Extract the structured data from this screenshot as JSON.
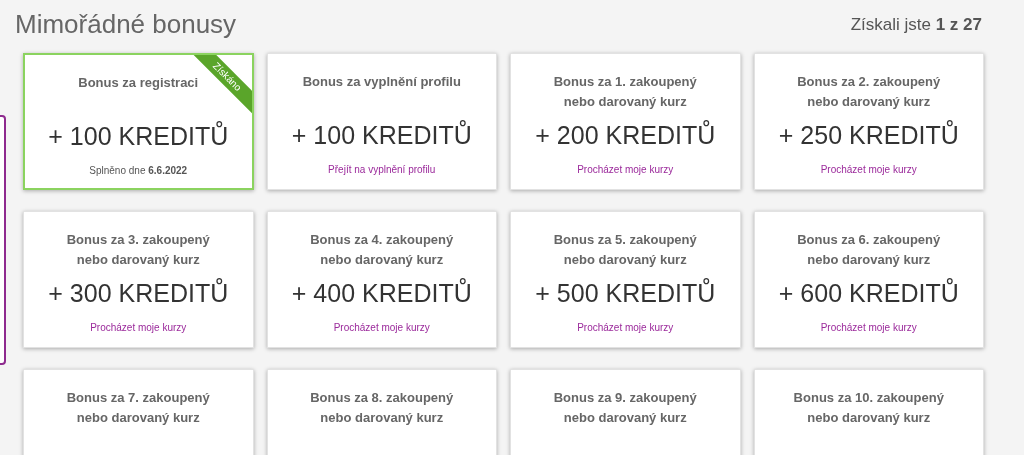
{
  "heading": "Mimořádné bonusy",
  "progress": "Získali jste **1 z 27**",
  "bonuses": [
    {
      "title": "Bonus za registraci",
      "amount": "+ 100 KREDITŮ",
      "footer": "Splněno dne **6.6.2022**",
      "earned": true,
      "ribbon": "Získáno"
    },
    {
      "title": "Bonus za vyplnění profilu",
      "amount": "+ 100 KREDITŮ",
      "footer": "Přejít na vyplnění profilu",
      "earned": false
    },
    {
      "title": "Bonus za 1. zakoupený nebo darovaný kurz",
      "amount": "+ 200 KREDITŮ",
      "footer": "Procházet moje kurzy",
      "earned": false
    },
    {
      "title": "Bonus za 2. zakoupený nebo darovaný kurz",
      "amount": "+ 250 KREDITŮ",
      "footer": "Procházet moje kurzy",
      "earned": false
    },
    {
      "title": "Bonus za 3. zakoupený nebo darovaný kurz",
      "amount": "+ 300 KREDITŮ",
      "footer": "Procházet moje kurzy",
      "earned": false
    },
    {
      "title": "Bonus za 4. zakoupený nebo darovaný kurz",
      "amount": "+ 400 KREDITŮ",
      "footer": "Procházet moje kurzy",
      "earned": false
    },
    {
      "title": "Bonus za 5. zakoupený nebo darovaný kurz",
      "amount": "+ 500 KREDITŮ",
      "footer": "Procházet moje kurzy",
      "earned": false
    },
    {
      "title": "Bonus za 6. zakoupený nebo darovaný kurz",
      "amount": "+ 600 KREDITŮ",
      "footer": "Procházet moje kurzy",
      "earned": false
    },
    {
      "title": "Bonus za 7. zakoupený nebo darovaný kurz",
      "earned": false
    },
    {
      "title": "Bonus za 8. zakoupený nebo darovaný kurz",
      "earned": false
    },
    {
      "title": "Bonus za 9. zakoupený nebo darovaný kurz",
      "earned": false
    },
    {
      "title": "Bonus za 10. zakoupený nebo darovaný kurz",
      "earned": false
    }
  ]
}
